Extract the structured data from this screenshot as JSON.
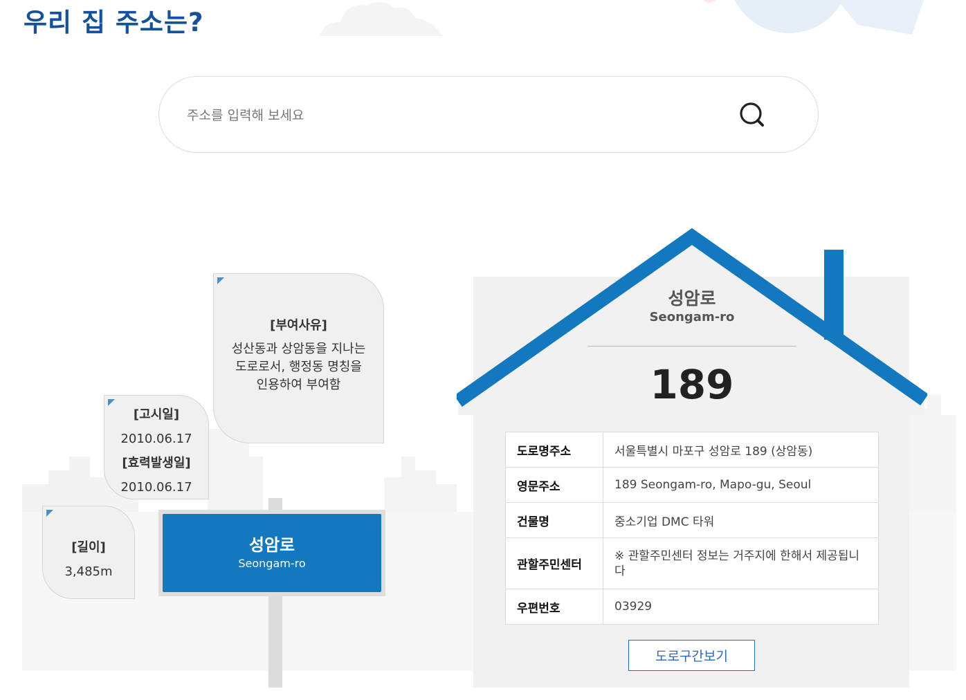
{
  "page_title": "우리 집 주소는?",
  "search": {
    "placeholder": "주소를 입력해 보세요",
    "icon": "search-icon"
  },
  "bubbles": {
    "reason": {
      "label": "[부여사유]",
      "text": "성산동과 상암동을 지나는 도로로서, 행정동 명칭을 인용하여 부여함"
    },
    "dates": {
      "notice_label": "[고시일]",
      "notice_date": "2010.06.17",
      "effective_label": "[효력발생일]",
      "effective_date": "2010.06.17"
    },
    "length": {
      "label": "[길이]",
      "value": "3,485m"
    }
  },
  "sign": {
    "name": "성암로",
    "english": "Seongam-ro"
  },
  "house": {
    "road_name": "성암로",
    "road_english": "Seongam-ro",
    "number": "189",
    "rows": [
      {
        "key": "도로명주소",
        "value": "서울특별시 마포구 성암로 189 (상암동)"
      },
      {
        "key": "영문주소",
        "value": "189 Seongam-ro, Mapo-gu, Seoul"
      },
      {
        "key": "건물명",
        "value": "중소기업 DMC 타워"
      },
      {
        "key": "관할주민센터",
        "value": "※ 관할주민센터 정보는 거주지에 한해서 제공됩니다"
      },
      {
        "key": "우편번호",
        "value": "03929"
      }
    ],
    "section_button": "도로구간보기"
  },
  "colors": {
    "title": "#15519a",
    "accent": "#1478be",
    "button": "#2a6bb5",
    "bubble_bg": "#f0f0f0",
    "house_bg": "#f1f1f1"
  }
}
